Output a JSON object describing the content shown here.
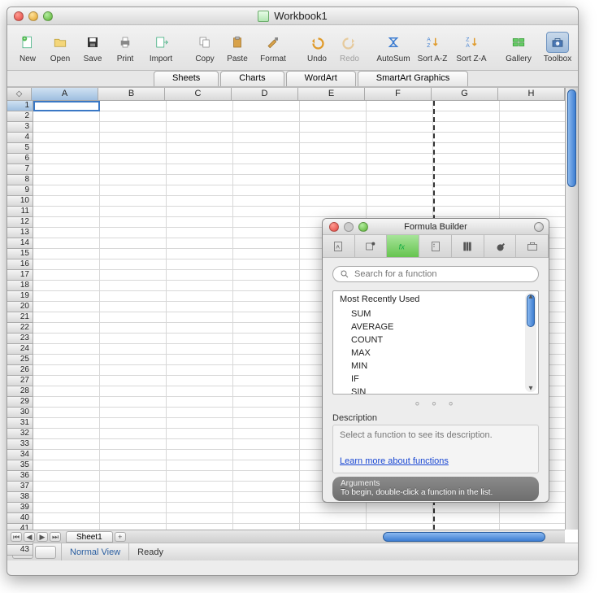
{
  "window": {
    "title": "Workbook1"
  },
  "toolbar": {
    "new": "New",
    "open": "Open",
    "save": "Save",
    "print": "Print",
    "import": "Import",
    "copy": "Copy",
    "paste": "Paste",
    "format": "Format",
    "undo": "Undo",
    "redo": "Redo",
    "autosum": "AutoSum",
    "sortaz": "Sort A-Z",
    "sortza": "Sort Z-A",
    "gallery": "Gallery",
    "toolbox": "Toolbox"
  },
  "tabs": {
    "sheets": "Sheets",
    "charts": "Charts",
    "wordart": "WordArt",
    "smartart": "SmartArt Graphics"
  },
  "columns": [
    "A",
    "B",
    "C",
    "D",
    "E",
    "F",
    "G",
    "H"
  ],
  "row_count": 43,
  "active_cell": {
    "col": "A",
    "row": 1
  },
  "worksheet_tab": "Sheet1",
  "status": {
    "view": "Normal View",
    "state": "Ready"
  },
  "palette": {
    "title": "Formula Builder",
    "search_placeholder": "Search for a function",
    "list_header": "Most Recently Used",
    "functions": [
      "SUM",
      "AVERAGE",
      "COUNT",
      "MAX",
      "MIN",
      "IF",
      "SIN"
    ],
    "description_label": "Description",
    "description_placeholder": "Select a function to see its description.",
    "learn_more": "Learn more about functions",
    "arguments_label": "Arguments",
    "arguments_hint": "To begin, double-click a function in the list."
  }
}
